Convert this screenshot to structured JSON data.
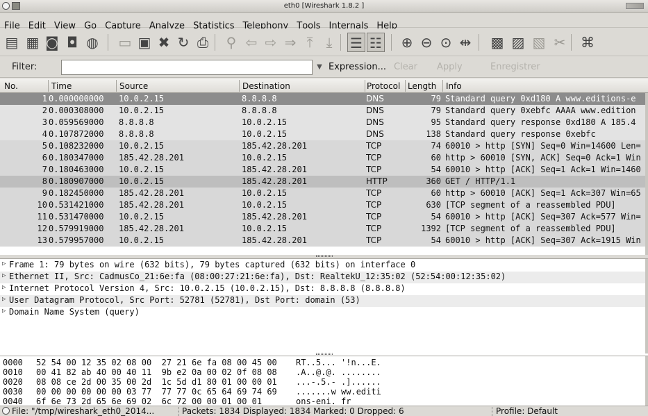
{
  "window": {
    "title": "eth0  [Wireshark 1.8.2 ]"
  },
  "menu": [
    {
      "pre": "",
      "key": "F",
      "post": "ile"
    },
    {
      "pre": "",
      "key": "E",
      "post": "dit"
    },
    {
      "pre": "",
      "key": "V",
      "post": "iew"
    },
    {
      "pre": "",
      "key": "G",
      "post": "o"
    },
    {
      "pre": "",
      "key": "C",
      "post": "apture"
    },
    {
      "pre": "",
      "key": "A",
      "post": "nalyze"
    },
    {
      "pre": "",
      "key": "S",
      "post": "tatistics"
    },
    {
      "pre": "Telephon",
      "key": "y",
      "post": ""
    },
    {
      "pre": "",
      "key": "T",
      "post": "ools"
    },
    {
      "pre": "",
      "key": "I",
      "post": "nternals"
    },
    {
      "pre": "",
      "key": "H",
      "post": "elp"
    }
  ],
  "toolbar": {
    "icons": [
      "interface-list-icon",
      "capture-options-icon",
      "capture-start-icon",
      "capture-stop-icon",
      "capture-restart-icon",
      "open-file-icon",
      "save-file-icon",
      "close-file-icon",
      "reload-file-icon",
      "print-icon",
      "find-packet-icon",
      "go-back-icon",
      "go-forward-icon",
      "go-to-packet-icon",
      "go-first-icon",
      "go-last-icon",
      "colorize-icon",
      "auto-scroll-icon",
      "zoom-in-icon",
      "zoom-out-icon",
      "zoom-normal-icon",
      "resize-columns-icon",
      "capture-filters-icon",
      "display-filters-icon",
      "coloring-rules-icon",
      "preferences-icon",
      "help-icon"
    ]
  },
  "filter": {
    "label": "Filter:",
    "value": "",
    "expression": "Expression...",
    "clear": "Clear",
    "apply": "Apply",
    "save": "Enregistrer"
  },
  "packet_list": {
    "columns": [
      "No.",
      "Time",
      "Source",
      "Destination",
      "Protocol",
      "Length",
      "Info"
    ],
    "rows": [
      {
        "no": "1",
        "time": "0.000000000",
        "src": "10.0.2.15",
        "dst": "8.8.8.8",
        "proto": "DNS",
        "len": "79",
        "info": "Standard query 0xd180  A www.editions-e",
        "kind": "sel"
      },
      {
        "no": "2",
        "time": "0.000308000",
        "src": "10.0.2.15",
        "dst": "8.8.8.8",
        "proto": "DNS",
        "len": "79",
        "info": "Standard query 0xebfc  AAAA www.edition",
        "kind": "dns"
      },
      {
        "no": "3",
        "time": "0.059569000",
        "src": "8.8.8.8",
        "dst": "10.0.2.15",
        "proto": "DNS",
        "len": "95",
        "info": "Standard query response 0xd180  A 185.4",
        "kind": "dns"
      },
      {
        "no": "4",
        "time": "0.107872000",
        "src": "8.8.8.8",
        "dst": "10.0.2.15",
        "proto": "DNS",
        "len": "138",
        "info": "Standard query response 0xebfc",
        "kind": "dns"
      },
      {
        "no": "5",
        "time": "0.108232000",
        "src": "10.0.2.15",
        "dst": "185.42.28.201",
        "proto": "TCP",
        "len": "74",
        "info": "60010 > http [SYN] Seq=0 Win=14600 Len=",
        "kind": "tcp"
      },
      {
        "no": "6",
        "time": "0.180347000",
        "src": "185.42.28.201",
        "dst": "10.0.2.15",
        "proto": "TCP",
        "len": "60",
        "info": "http > 60010 [SYN, ACK] Seq=0 Ack=1 Win",
        "kind": "tcp"
      },
      {
        "no": "7",
        "time": "0.180463000",
        "src": "10.0.2.15",
        "dst": "185.42.28.201",
        "proto": "TCP",
        "len": "54",
        "info": "60010 > http [ACK] Seq=1 Ack=1 Win=1460",
        "kind": "tcp"
      },
      {
        "no": "8",
        "time": "0.180907000",
        "src": "10.0.2.15",
        "dst": "185.42.28.201",
        "proto": "HTTP",
        "len": "360",
        "info": "GET / HTTP/1.1",
        "kind": "http"
      },
      {
        "no": "9",
        "time": "0.182450000",
        "src": "185.42.28.201",
        "dst": "10.0.2.15",
        "proto": "TCP",
        "len": "60",
        "info": "http > 60010 [ACK] Seq=1 Ack=307 Win=65",
        "kind": "tcp"
      },
      {
        "no": "10",
        "time": "0.531421000",
        "src": "185.42.28.201",
        "dst": "10.0.2.15",
        "proto": "TCP",
        "len": "630",
        "info": "[TCP segment of a reassembled PDU]",
        "kind": "tcp"
      },
      {
        "no": "11",
        "time": "0.531470000",
        "src": "10.0.2.15",
        "dst": "185.42.28.201",
        "proto": "TCP",
        "len": "54",
        "info": "60010 > http [ACK] Seq=307 Ack=577 Win=",
        "kind": "tcp"
      },
      {
        "no": "12",
        "time": "0.579919000",
        "src": "185.42.28.201",
        "dst": "10.0.2.15",
        "proto": "TCP",
        "len": "1392",
        "info": "[TCP segment of a reassembled PDU]",
        "kind": "tcp"
      },
      {
        "no": "13",
        "time": "0.579957000",
        "src": "10.0.2.15",
        "dst": "185.42.28.201",
        "proto": "TCP",
        "len": "54",
        "info": "60010 > http [ACK] Seq=307 Ack=1915 Win",
        "kind": "tcp"
      }
    ]
  },
  "details": [
    "Frame 1: 79 bytes on wire (632 bits), 79 bytes captured (632 bits) on interface 0",
    "Ethernet II, Src: CadmusCo_21:6e:fa (08:00:27:21:6e:fa), Dst: RealtekU_12:35:02 (52:54:00:12:35:02)",
    "Internet Protocol Version 4, Src: 10.0.2.15 (10.0.2.15), Dst: 8.8.8.8 (8.8.8.8)",
    "User Datagram Protocol, Src Port: 52781 (52781), Dst Port: domain (53)",
    "Domain Name System (query)"
  ],
  "bytes": [
    {
      "off": "0000",
      "hex": "52 54 00 12 35 02 08 00  27 21 6e fa 08 00 45 00",
      "ascii": "RT..5... '!n...E."
    },
    {
      "off": "0010",
      "hex": "00 41 82 ab 40 00 40 11  9b e2 0a 00 02 0f 08 08",
      "ascii": ".A..@.@. ........"
    },
    {
      "off": "0020",
      "hex": "08 08 ce 2d 00 35 00 2d  1c 5d d1 80 01 00 00 01",
      "ascii": "...-.5.- .]......"
    },
    {
      "off": "0030",
      "hex": "00 00 00 00 00 00 03 77  77 77 0c 65 64 69 74 69",
      "ascii": ".......w ww.editi"
    },
    {
      "off": "0040",
      "hex": "6f 6e 73 2d 65 6e 69 02  6c 72 00 00 01 00 01",
      "ascii": "ons-eni. fr"
    }
  ],
  "status": {
    "file": "File: \"/tmp/wireshark_eth0_2014...",
    "packets": "Packets: 1834 Displayed: 1834 Marked: 0 Dropped: 6",
    "profile": "Profile: Default"
  }
}
